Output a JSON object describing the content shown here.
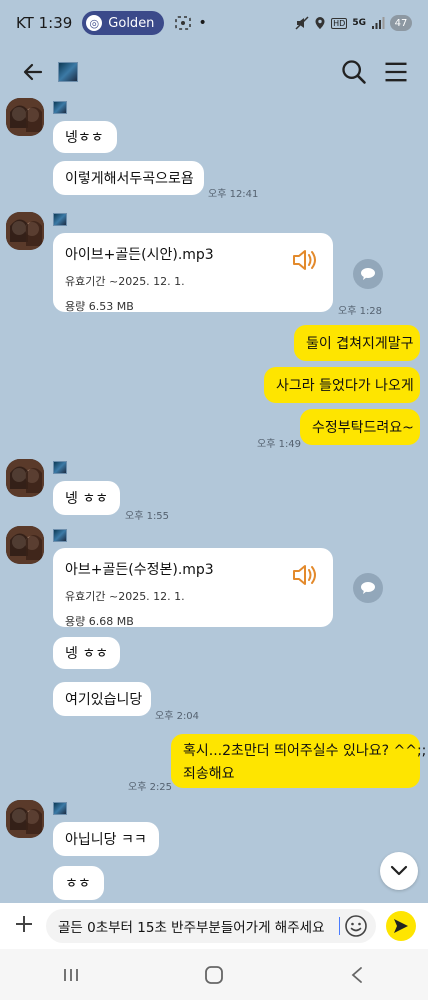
{
  "status": {
    "carrier_time": "KT 1:39",
    "pill_label": "Golden",
    "battery": "47",
    "hd": "HD",
    "net": "5G"
  },
  "header": {
    "back_icon": "arrow-left-icon",
    "search_icon": "search-icon",
    "menu_icon": "hamburger-icon"
  },
  "messages": [
    {
      "text": "넹ㅎㅎ"
    },
    {
      "text": "이렇게해서두곡으로욤",
      "time": "오후 12:41"
    },
    {
      "file": "아이브+골든(시안).mp3",
      "expiry": "유효기간 ~2025. 12. 1.",
      "size": "용량  6.53 MB",
      "time": "오후 1:28"
    },
    {
      "text": "둘이 겹쳐지게말구"
    },
    {
      "text": "사그라 들었다가 나오게"
    },
    {
      "text": "수정부탁드려요~",
      "time": "오후 1:49"
    },
    {
      "text": "넹 ㅎㅎ",
      "time": "오후 1:55"
    },
    {
      "file": "아브+골든(수정본).mp3",
      "expiry": "유효기간 ~2025. 12. 1.",
      "size": "용량  6.68 MB"
    },
    {
      "text": "넹 ㅎㅎ"
    },
    {
      "text": "여기있습니당",
      "time": "오후 2:04"
    },
    {
      "line1": "혹시...2초만더 띄어주실수 있나요? ^^;;",
      "line2": "죄송해요",
      "time": "오후 2:25"
    },
    {
      "text": "아닙니당 ㅋㅋ"
    },
    {
      "text": "ㅎㅎ"
    }
  ],
  "input": {
    "value": "골든 0초부터 15초 반주부분들어가게 해주세요"
  },
  "colors": {
    "background": "#b2c7d9",
    "my_bubble": "#fee500",
    "other_bubble": "#ffffff",
    "speaker": "#e38a2c"
  }
}
